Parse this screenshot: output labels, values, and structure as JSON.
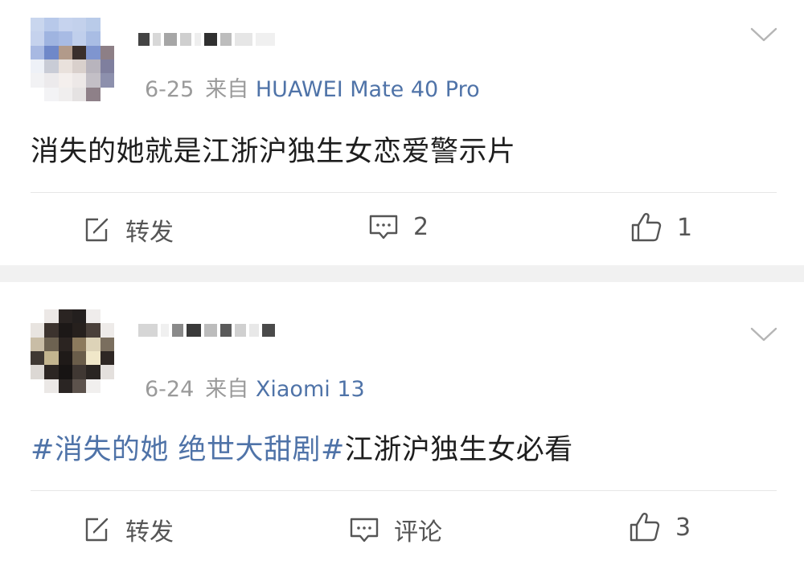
{
  "posts": [
    {
      "date": "6-25",
      "source_prefix": "来自",
      "device": "HUAWEI Mate 40 Pro",
      "content": "消失的她就是江浙沪独生女恋爱警示片",
      "repost_label": "转发",
      "comment_label": "2",
      "like_count": "1"
    },
    {
      "date": "6-24",
      "source_prefix": "来自",
      "device": "Xiaomi 13",
      "hashtag": "#消失的她 绝世大甜剧#",
      "content_rest": "江浙沪独生女必看",
      "repost_label": "转发",
      "comment_label": "评论",
      "like_count": "3"
    }
  ],
  "colors": {
    "link_blue": "#4f73a8",
    "meta_gray": "#9a9a9a",
    "separator_gray": "#f1f1f1",
    "icon_gray": "#555555"
  },
  "icons": {
    "repost": "edit-square-icon",
    "comment": "comment-bubble-icon",
    "like": "thumbs-up-icon",
    "menu": "chevron-down-icon"
  }
}
